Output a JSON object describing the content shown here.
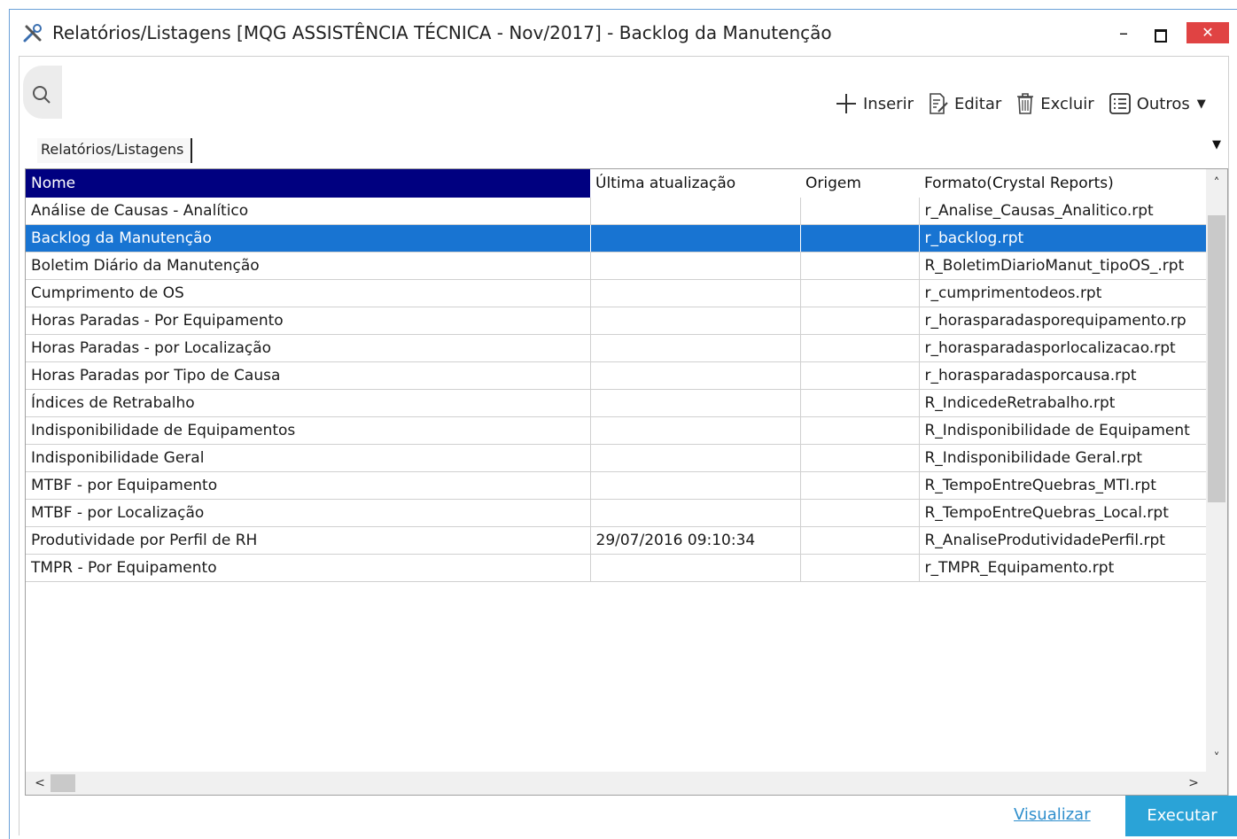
{
  "window": {
    "title": "Relatórios/Listagens [MQG ASSISTÊNCIA TÉCNICA - Nov/2017]  - Backlog da Manutenção",
    "minimize_label": "–",
    "close_label": "✕"
  },
  "toolbar": {
    "insert_label": "Inserir",
    "edit_label": "Editar",
    "delete_label": "Excluir",
    "others_label": "Outros",
    "others_arrow": "▼"
  },
  "tabs": {
    "active_label": "Relatórios/Listagens",
    "menu_arrow": "▼"
  },
  "grid": {
    "columns": [
      "Nome",
      "Última atualização",
      "Origem",
      "Formato(Crystal Reports)"
    ],
    "rows": [
      [
        "Análise de Causas - Analítico",
        "",
        "",
        "r_Analise_Causas_Analitico.rpt"
      ],
      [
        "Backlog da Manutenção",
        "",
        "",
        "r_backlog.rpt"
      ],
      [
        "Boletim Diário da Manutenção",
        "",
        "",
        "R_BoletimDiarioManut_tipoOS_.rpt"
      ],
      [
        "Cumprimento de OS",
        "",
        "",
        "r_cumprimentodeos.rpt"
      ],
      [
        "Horas Paradas - Por Equipamento",
        "",
        "",
        "r_horasparadasporequipamento.rp"
      ],
      [
        "Horas Paradas - por Localização",
        "",
        "",
        "r_horasparadasporlocalizacao.rpt"
      ],
      [
        "Horas Paradas por Tipo de Causa",
        "",
        "",
        "r_horasparadasporcausa.rpt"
      ],
      [
        "Índices de Retrabalho",
        "",
        "",
        "R_IndicedeRetrabalho.rpt"
      ],
      [
        "Indisponibilidade de Equipamentos",
        "",
        "",
        "R_Indisponibilidade de Equipament"
      ],
      [
        "Indisponibilidade Geral",
        "",
        "",
        "R_Indisponibilidade Geral.rpt"
      ],
      [
        "MTBF - por Equipamento",
        "",
        "",
        "R_TempoEntreQuebras_MTI.rpt"
      ],
      [
        "MTBF - por Localização",
        "",
        "",
        "R_TempoEntreQuebras_Local.rpt"
      ],
      [
        "Produtividade por Perfil de RH",
        "29/07/2016 09:10:34",
        "",
        "R_AnaliseProdutividadePerfil.rpt"
      ],
      [
        "TMPR - Por Equipamento",
        "",
        "",
        "r_TMPR_Equipamento.rpt"
      ]
    ],
    "selected_row": 1,
    "scroll_up": "˄",
    "scroll_down": "˅",
    "scroll_left": "<",
    "scroll_right": ">"
  },
  "footer": {
    "view_label": "Visualizar",
    "run_label": "Executar"
  },
  "colors": {
    "accent": "#2aa3d7",
    "selection": "#1874d2",
    "header_active": "#000080",
    "close": "#e04343"
  }
}
